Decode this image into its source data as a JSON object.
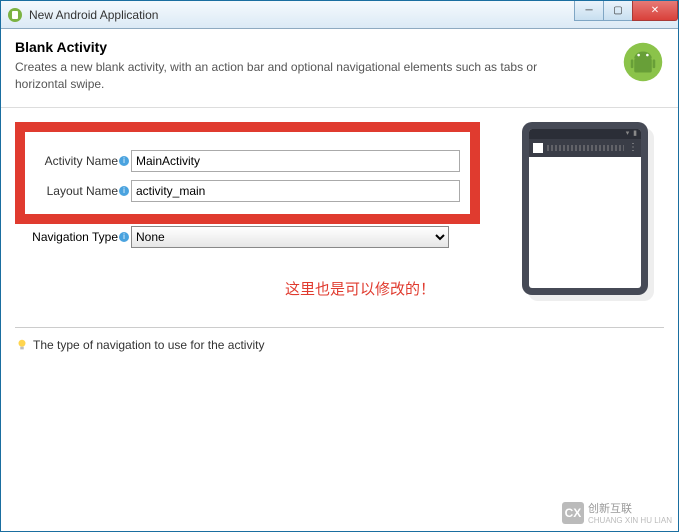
{
  "window": {
    "title": "New Android Application"
  },
  "banner": {
    "heading": "Blank Activity",
    "description": "Creates a new blank activity, with an action bar and optional navigational elements such as tabs or horizontal swipe."
  },
  "form": {
    "activity_name_label": "Activity Name",
    "activity_name_value": "MainActivity",
    "layout_name_label": "Layout Name",
    "layout_name_value": "activity_main",
    "navigation_type_label": "Navigation Type",
    "navigation_type_value": "None"
  },
  "annotation": "这里也是可以修改的！",
  "hint": "The type of navigation to use for the activity",
  "watermark": {
    "brand": "创新互联",
    "sub": "CHUANG XIN HU LIAN",
    "logo": "CX"
  }
}
